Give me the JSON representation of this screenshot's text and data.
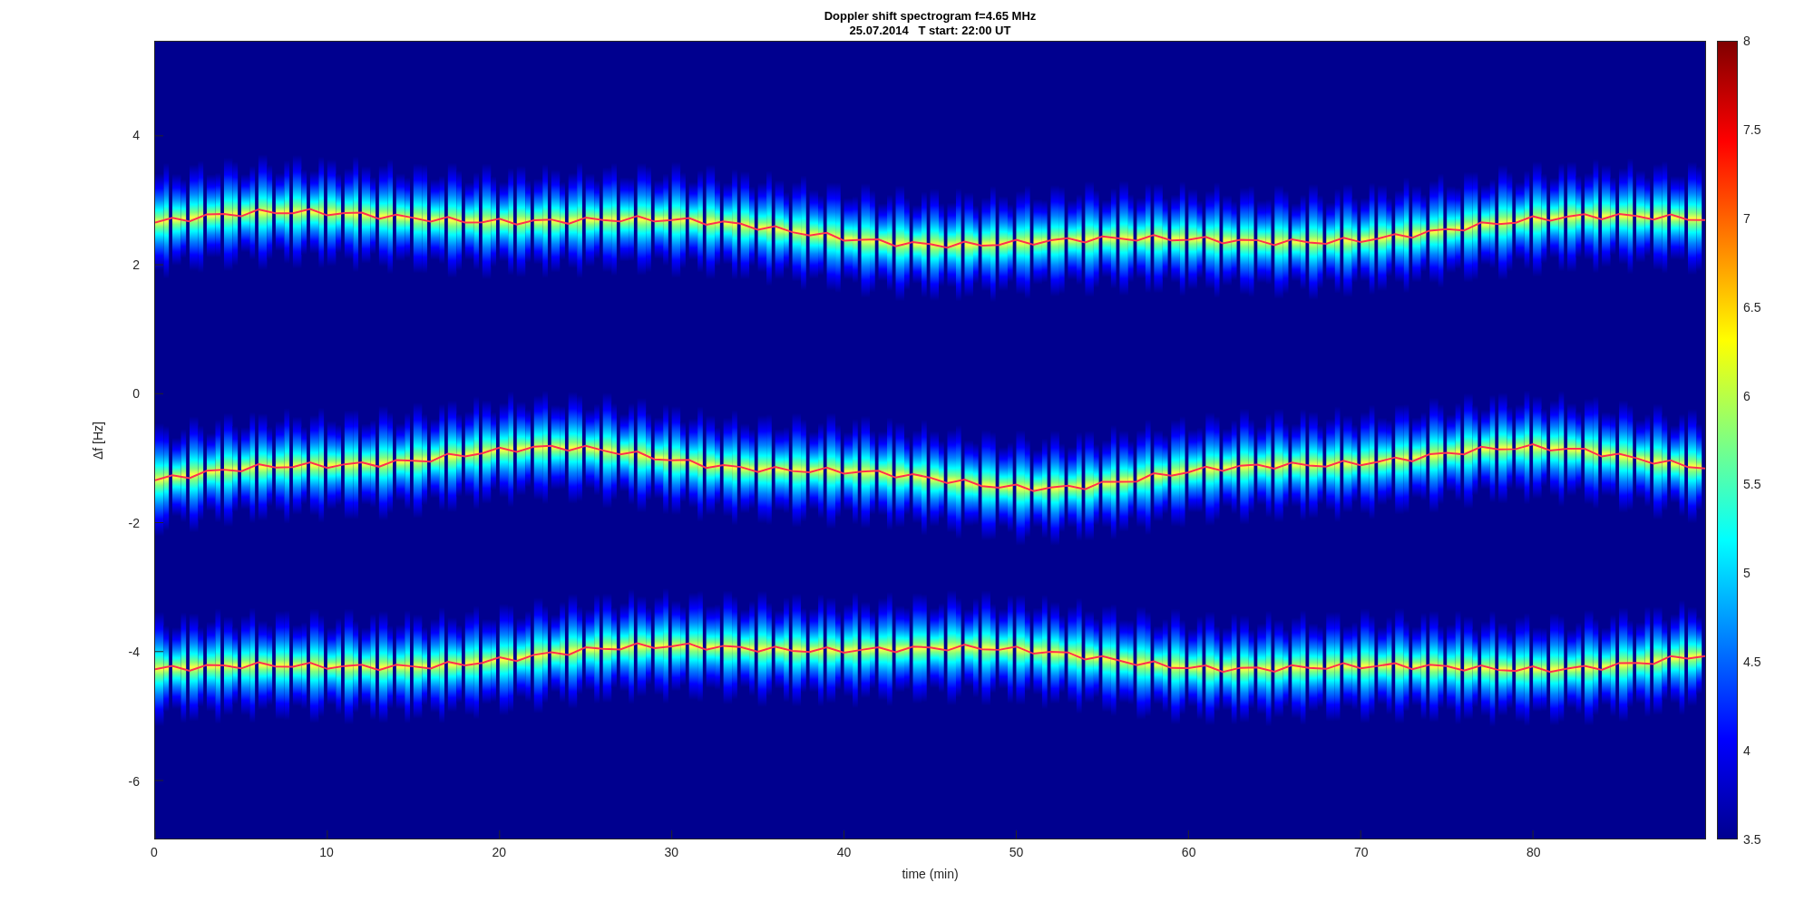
{
  "spectrogram": {
    "title": "Doppler shift spectrogram f=4.65 MHz",
    "subtitle": "25.07.2014   T start: 22:00 UT",
    "xlabel": "time (min)",
    "ylabel": "Δf [Hz]",
    "xticks": [
      "0",
      "10",
      "20",
      "30",
      "40",
      "50",
      "60",
      "70",
      "80"
    ],
    "yticks": [
      "4",
      "2",
      "0",
      "-2",
      "-4",
      "-6"
    ]
  },
  "colorbar": {
    "ticks": [
      "8",
      "7.5",
      "7",
      "6.5",
      "6",
      "5.5",
      "5",
      "4.5",
      "4",
      "3.5"
    ]
  }
}
